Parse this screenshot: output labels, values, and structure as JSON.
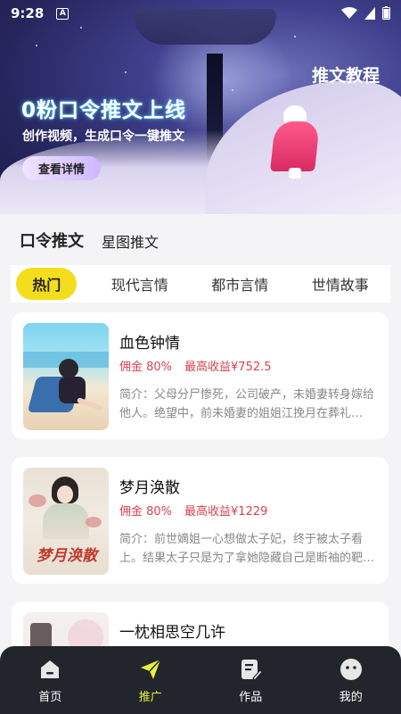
{
  "status_bar": {
    "time": "9:28",
    "notif_letter": "A"
  },
  "banner": {
    "title": "0粉口令推文上线",
    "subtitle": "创作视频，生成口令一键推文",
    "button_label": "查看详情",
    "tutorial_label": "推文教程"
  },
  "top_tabs": [
    {
      "label": "口令推文",
      "active": true
    },
    {
      "label": "星图推文",
      "active": false
    }
  ],
  "categories": [
    {
      "label": "热门",
      "active": true
    },
    {
      "label": "现代言情",
      "active": false
    },
    {
      "label": "都市言情",
      "active": false
    },
    {
      "label": "世情故事",
      "active": false
    }
  ],
  "books": [
    {
      "title": "血色钟情",
      "commission": "佣金 80%",
      "max_earning": "最高收益¥752.5",
      "description": "简介：父母分尸惨死，公司破产，未婚妻转身嫁给他人。绝望中，前未婚妻的姐姐江挽月在葬礼…"
    },
    {
      "title": "梦月涣散",
      "commission": "佣金 80%",
      "max_earning": "最高收益¥1229",
      "description": "简介：前世嫡姐一心想做太子妃，终于被太子看上。结果太子只是为了拿她隐藏自己是断袖的靶…",
      "cover_text": "梦月涣散"
    },
    {
      "title": "一枕相思空几许",
      "commission": "",
      "max_earning": "",
      "description": ""
    }
  ],
  "bottom_nav": [
    {
      "label": "首页",
      "icon": "home-icon",
      "active": false
    },
    {
      "label": "推广",
      "icon": "send-icon",
      "active": true
    },
    {
      "label": "作品",
      "icon": "edit-doc-icon",
      "active": false
    },
    {
      "label": "我的",
      "icon": "profile-icon",
      "active": false
    }
  ],
  "colors": {
    "accent_yellow": "#f4dd1c",
    "nav_active": "#e6f23a",
    "earn_red": "#d8414f",
    "nav_bg": "#22252b"
  }
}
